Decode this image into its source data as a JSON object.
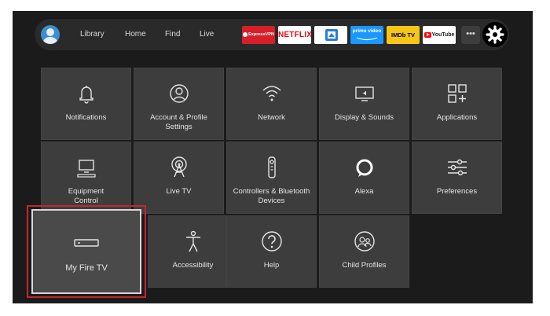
{
  "nav": {
    "links": [
      "Library",
      "Home",
      "Find",
      "Live"
    ],
    "apps": {
      "expressvpn": "ExpressVPN",
      "netflix": "NETFLIX",
      "prime": "prime video",
      "imdb": "IMDb TV",
      "youtube": "YouTube"
    },
    "more": "•••"
  },
  "settings": {
    "notifications": "Notifications",
    "account_line1": "Account & Profile",
    "account_line2": "Settings",
    "network": "Network",
    "display_sounds": "Display & Sounds",
    "applications": "Applications",
    "equipment_line1": "Equipment",
    "equipment_line2": "Control",
    "live_tv": "Live TV",
    "controllers_line1": "Controllers & Bluetooth",
    "controllers_line2": "Devices",
    "alexa": "Alexa",
    "preferences": "Preferences",
    "my_fire_tv": "My Fire TV",
    "accessibility": "Accessibility",
    "help": "Help",
    "child_profiles": "Child Profiles"
  },
  "colors": {
    "background": "#1b1b1b",
    "tile": "#3d3d3d",
    "focus_outline": "#c6262e",
    "avatar": "#3a8fd1"
  },
  "icons": [
    "bell-icon",
    "user-circle-icon",
    "wifi-icon",
    "display-icon",
    "apps-grid-icon",
    "monitor-icon",
    "antenna-icon",
    "remote-icon",
    "alexa-ring-icon",
    "sliders-icon",
    "firetv-stick-icon",
    "accessibility-icon",
    "question-icon",
    "child-profiles-icon",
    "gear-icon"
  ]
}
